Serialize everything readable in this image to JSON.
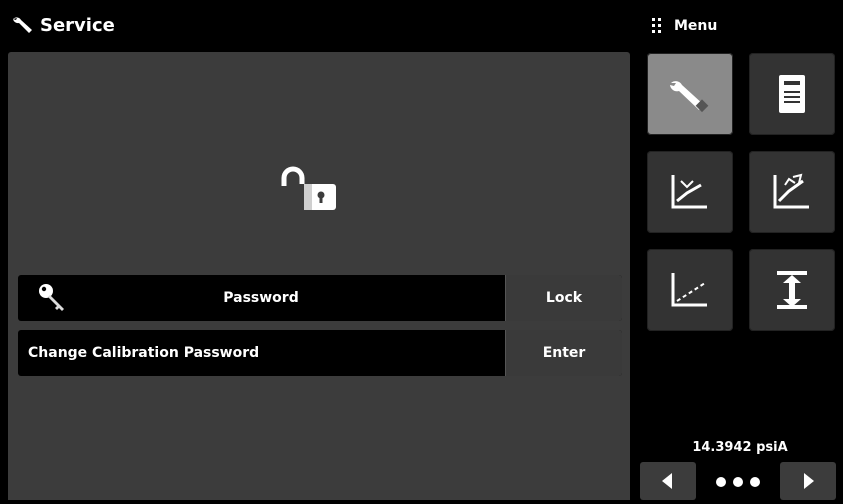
{
  "header": {
    "title": "Service",
    "icon": "wrench-icon"
  },
  "menu": {
    "label": "Menu",
    "icon": "grip-dots-icon"
  },
  "panel": {
    "lock_icon": "unlocked-padlock-icon",
    "password_row": {
      "icon": "key-icon",
      "label": "Password",
      "button_label": "Lock"
    },
    "calibration_row": {
      "label": "Change Calibration Password",
      "button_label": "Enter"
    }
  },
  "menu_tiles": [
    {
      "icon": "wrench-icon",
      "active": true
    },
    {
      "icon": "document-icon",
      "active": false
    },
    {
      "icon": "calibration-curve-icon",
      "active": false
    },
    {
      "icon": "calibration-adjust-icon",
      "active": false
    },
    {
      "icon": "linear-graph-icon",
      "active": false
    },
    {
      "icon": "range-height-icon",
      "active": false
    }
  ],
  "status": {
    "pressure_reading": "14.3942 psiA"
  },
  "pager": {
    "prev_icon": "arrow-left-icon",
    "next_icon": "arrow-right-icon",
    "dots": 3
  },
  "colors": {
    "background": "#000000",
    "panel": "#3c3c3c",
    "active_tile": "#8a8a8a",
    "tile": "#333333"
  }
}
